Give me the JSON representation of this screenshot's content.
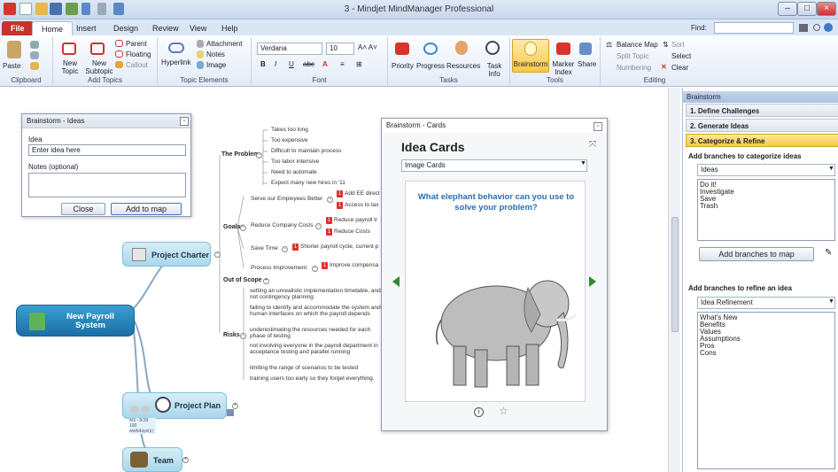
{
  "window": {
    "title": "3 - Mindjet MindManager Professional"
  },
  "tabs": [
    {
      "label": "File"
    },
    {
      "label": "Home"
    },
    {
      "label": "Insert"
    },
    {
      "label": "Design"
    },
    {
      "label": "Review"
    },
    {
      "label": "View"
    },
    {
      "label": "Help"
    }
  ],
  "find_label": "Find:",
  "ribbon": {
    "paste": "Paste",
    "new_topic": "New Topic",
    "new_subtopic": "New Subtopic",
    "parent": "Parent",
    "floating": "Floating",
    "callout": "Callout",
    "hyperlink": "Hyperlink",
    "attachment": "Attachment",
    "notes": "Notes",
    "image": "Image",
    "font_name": "Verdana",
    "font_size": "10",
    "priority": "Priority",
    "progress": "Progress",
    "resources": "Resources",
    "task_info": "Task Info",
    "brainstorm": "Brainstorm",
    "marker_index": "Marker Index",
    "share": "Share",
    "balance_map": "Balance Map",
    "sort": "Sort",
    "split_topic": "Split Topic",
    "select": "Select",
    "numbering": "Numbering",
    "clear": "Clear",
    "groups": {
      "clipboard": "Clipboard",
      "add_topics": "Add Topics",
      "topic_elements": "Topic Elements",
      "font": "Font",
      "tasks": "Tasks",
      "tools": "Tools",
      "editing": "Editing"
    }
  },
  "ideas_dialog": {
    "title": "Brainstorm - Ideas",
    "idea_label": "Idea",
    "idea_value": "Enter idea here",
    "notes_label": "Notes (optional)",
    "close": "Close",
    "add": "Add to map"
  },
  "cards_dialog": {
    "title": "Brainstorm - Cards",
    "heading": "Idea Cards",
    "dropdown": "Image Cards",
    "question": "What elephant behavior can you use to solve your problem?"
  },
  "map": {
    "central": "New Payroll System",
    "charter": "Project Charter",
    "plan": "Project Plan",
    "plan_meta1": "4/3 - 8/28",
    "plan_meta2": "100 workdays(s)",
    "team": "Team",
    "problem": "The Problem",
    "problem_items": [
      "Takes too long",
      "Too expensive",
      "Difficult to maintain process",
      "Too labor intensive",
      "Need to automate",
      "Expect many new hires in '11"
    ],
    "goals": "Goals",
    "goal_items": [
      {
        "text": "Serve our Employees Better",
        "subs": [
          "Add EE direct",
          "Access to tax"
        ]
      },
      {
        "text": "Reduce Company Costs",
        "subs": [
          "Reduce payroll tr",
          "Reduce Costs"
        ]
      },
      {
        "text": "Save Time",
        "subs": [
          "Shorter payroll cycle, current p"
        ]
      },
      {
        "text": "Process Improvement",
        "subs": [
          "Improve compensa"
        ]
      }
    ],
    "out_of_scope": "Out of Scope",
    "risks": "Risks",
    "risk_items": [
      "setting an unrealistic implementation timetable, and not contingency planning",
      "failing to identify and accommodate the system and human interfaces on which the payroll depends",
      "underestimating the resources needed for each phase of testing",
      "not involving everyone in the payroll department in acceptance testing and parallel running",
      "limiting the range of scenarios to be tested",
      "training users too early so they forget everything."
    ]
  },
  "pane": {
    "title": "Brainstorm",
    "steps": [
      "1. Define Challenges",
      "2. Generate Ideas",
      "3. Categorize & Refine"
    ],
    "categorize_label": "Add branches to categorize ideas",
    "categorize_select": "Ideas",
    "categorize_items": [
      "Do it!",
      "Investigate",
      "Save",
      "Trash"
    ],
    "add_branches_btn": "Add branches to map",
    "refine_label": "Add branches to refine an idea",
    "refine_select": "Idea Refinement",
    "refine_items": [
      "What's New",
      "Benefits",
      "Values",
      "Assumptions",
      "Pros",
      "Cons"
    ]
  }
}
